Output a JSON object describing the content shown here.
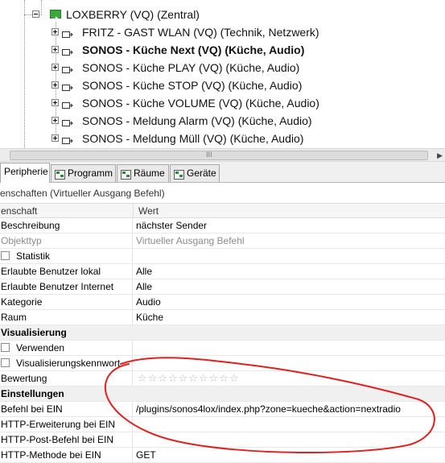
{
  "tree": {
    "top_partial_label": "",
    "root": {
      "label": "LOXBERRY (VQ) (Zentral)"
    },
    "items": [
      {
        "label": "FRITZ - GAST WLAN (VQ) (Technik, Netzwerk)",
        "bold": false
      },
      {
        "label": "SONOS - Küche Next (VQ) (Küche, Audio)",
        "bold": true
      },
      {
        "label": "SONOS - Küche PLAY (VQ) (Küche, Audio)",
        "bold": false
      },
      {
        "label": "SONOS - Küche STOP (VQ) (Küche, Audio)",
        "bold": false
      },
      {
        "label": "SONOS - Küche VOLUME (VQ) (Küche, Audio)",
        "bold": false
      },
      {
        "label": "SONOS - Meldung Alarm (VQ) (Küche, Audio)",
        "bold": false
      },
      {
        "label": "SONOS - Meldung Müll (VQ) (Küche, Audio)",
        "bold": false
      }
    ]
  },
  "scrollbar": {
    "grip": "III"
  },
  "tabs": [
    {
      "label": "Peripherie",
      "active": true
    },
    {
      "label": "Programm",
      "active": false
    },
    {
      "label": "Räume",
      "active": false
    },
    {
      "label": "Geräte",
      "active": false
    }
  ],
  "properties": {
    "title": "enschaften (Virtueller Ausgang Befehl)",
    "header": {
      "key": "enschaft",
      "value": "Wert"
    },
    "rows": [
      {
        "key": "Beschreibung",
        "value": "nächster Sender"
      },
      {
        "key": "Objekttyp",
        "value": "Virtueller Ausgang Befehl",
        "muted": true
      },
      {
        "key": "Statistik",
        "value": "",
        "checkbox": true
      },
      {
        "key": "Erlaubte Benutzer lokal",
        "value": "Alle"
      },
      {
        "key": "Erlaubte Benutzer Internet",
        "value": "Alle"
      },
      {
        "key": "Kategorie",
        "value": "Audio"
      },
      {
        "key": "Raum",
        "value": "Küche"
      },
      {
        "key": "Visualisierung",
        "value": "",
        "category": true
      },
      {
        "key": "Verwenden",
        "value": "",
        "checkbox": true
      },
      {
        "key": "Visualisierungskennwort",
        "value": "",
        "checkbox": true
      },
      {
        "key": "Bewertung",
        "value": "☆☆☆☆☆☆☆☆☆☆",
        "stars": true
      },
      {
        "key": "Einstellungen",
        "value": "",
        "category": true
      },
      {
        "key": "Befehl bei EIN",
        "value": "/plugins/sonos4lox/index.php?zone=kueche&action=nextradio"
      },
      {
        "key": "HTTP-Erweiterung bei EIN",
        "value": ""
      },
      {
        "key": "HTTP-Post-Befehl bei EIN",
        "value": ""
      },
      {
        "key": "HTTP-Methode bei EIN",
        "value": "GET"
      }
    ]
  },
  "colors": {
    "annotation": "#e02020",
    "root_icon": "#3aa83a"
  }
}
